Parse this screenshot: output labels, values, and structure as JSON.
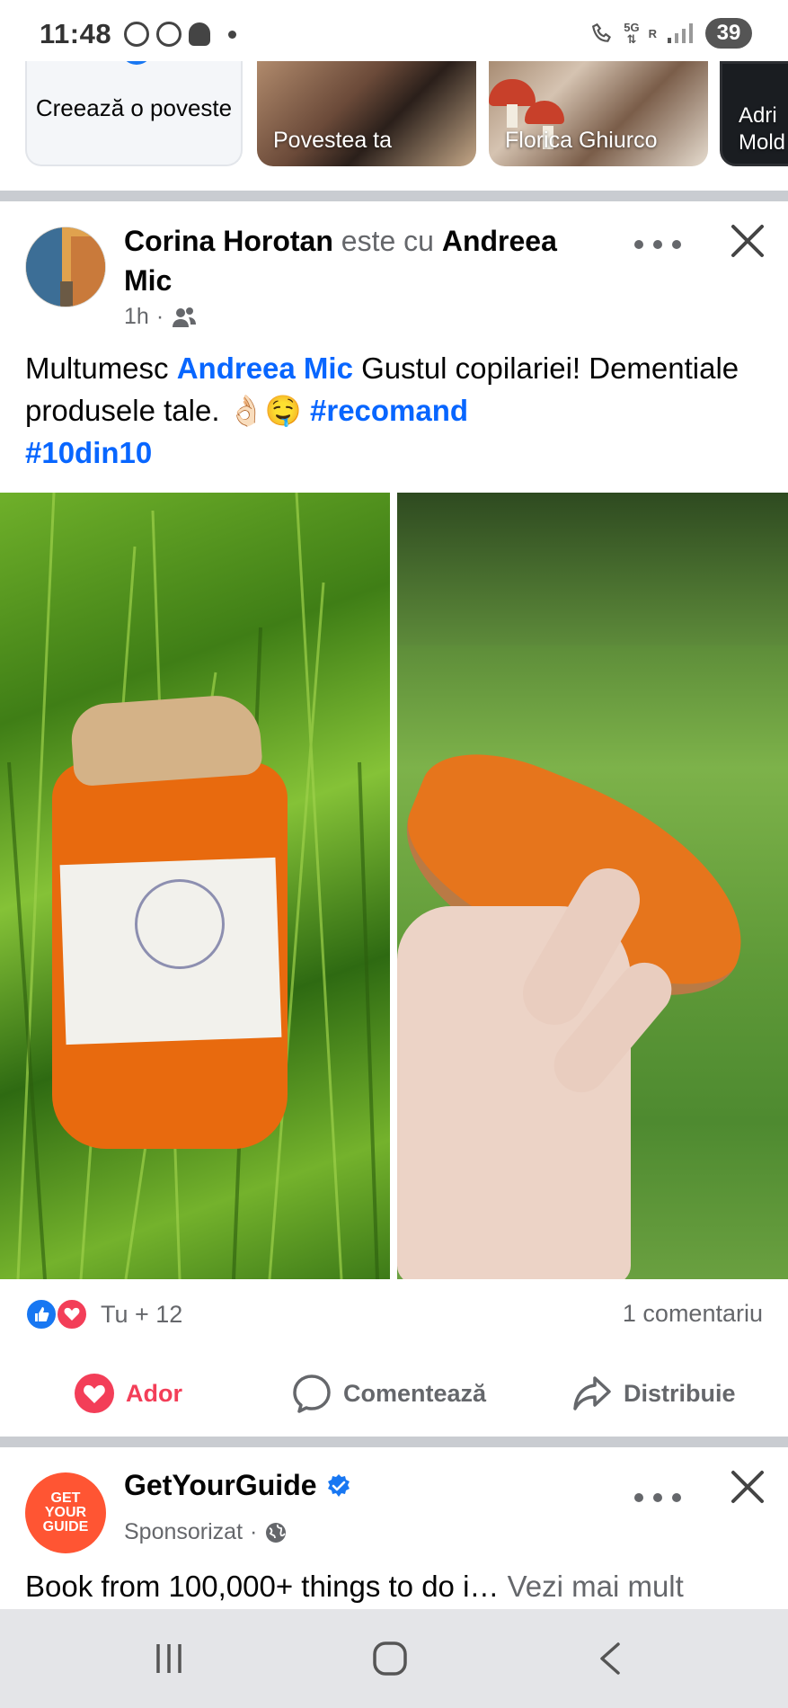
{
  "status_bar": {
    "time": "11:48",
    "network": "5G",
    "network_sub": "R",
    "battery": "39"
  },
  "stories": {
    "create": "Creează o poveste",
    "items": [
      {
        "label": "Povestea ta"
      },
      {
        "label": "Florica Ghiurco"
      },
      {
        "label": "Adri Mold"
      }
    ]
  },
  "post": {
    "author": "Corina Horotan",
    "with_word": "este cu",
    "tagged": "Andreea Mic",
    "time": "1h",
    "audience_icon": "friends-icon",
    "text_before": "Multumesc",
    "text_mention": "Andreea Mic",
    "text_after": "Gustul copilariei! Dementiale produsele tale. 👌🏻🤤",
    "hashtag1": "#recomand",
    "hashtag2": "#10din10",
    "reactions_count": "Tu + 12",
    "comments_count": "1 comentariu",
    "actions": {
      "love": "Ador",
      "comment": "Comentează",
      "share": "Distribuie"
    }
  },
  "sponsored": {
    "name": "GetYourGuide",
    "label": "Sponsorizat",
    "logo_text": [
      "GET",
      "YOUR",
      "GUIDE"
    ],
    "text": "Book from 100,000+ things to do i…",
    "see_more": "Vezi mai mult"
  },
  "colors": {
    "link": "#0866ff",
    "love": "#f33e58",
    "like": "#1877f2",
    "muted": "#65676b",
    "separator": "#c9ccd1"
  }
}
